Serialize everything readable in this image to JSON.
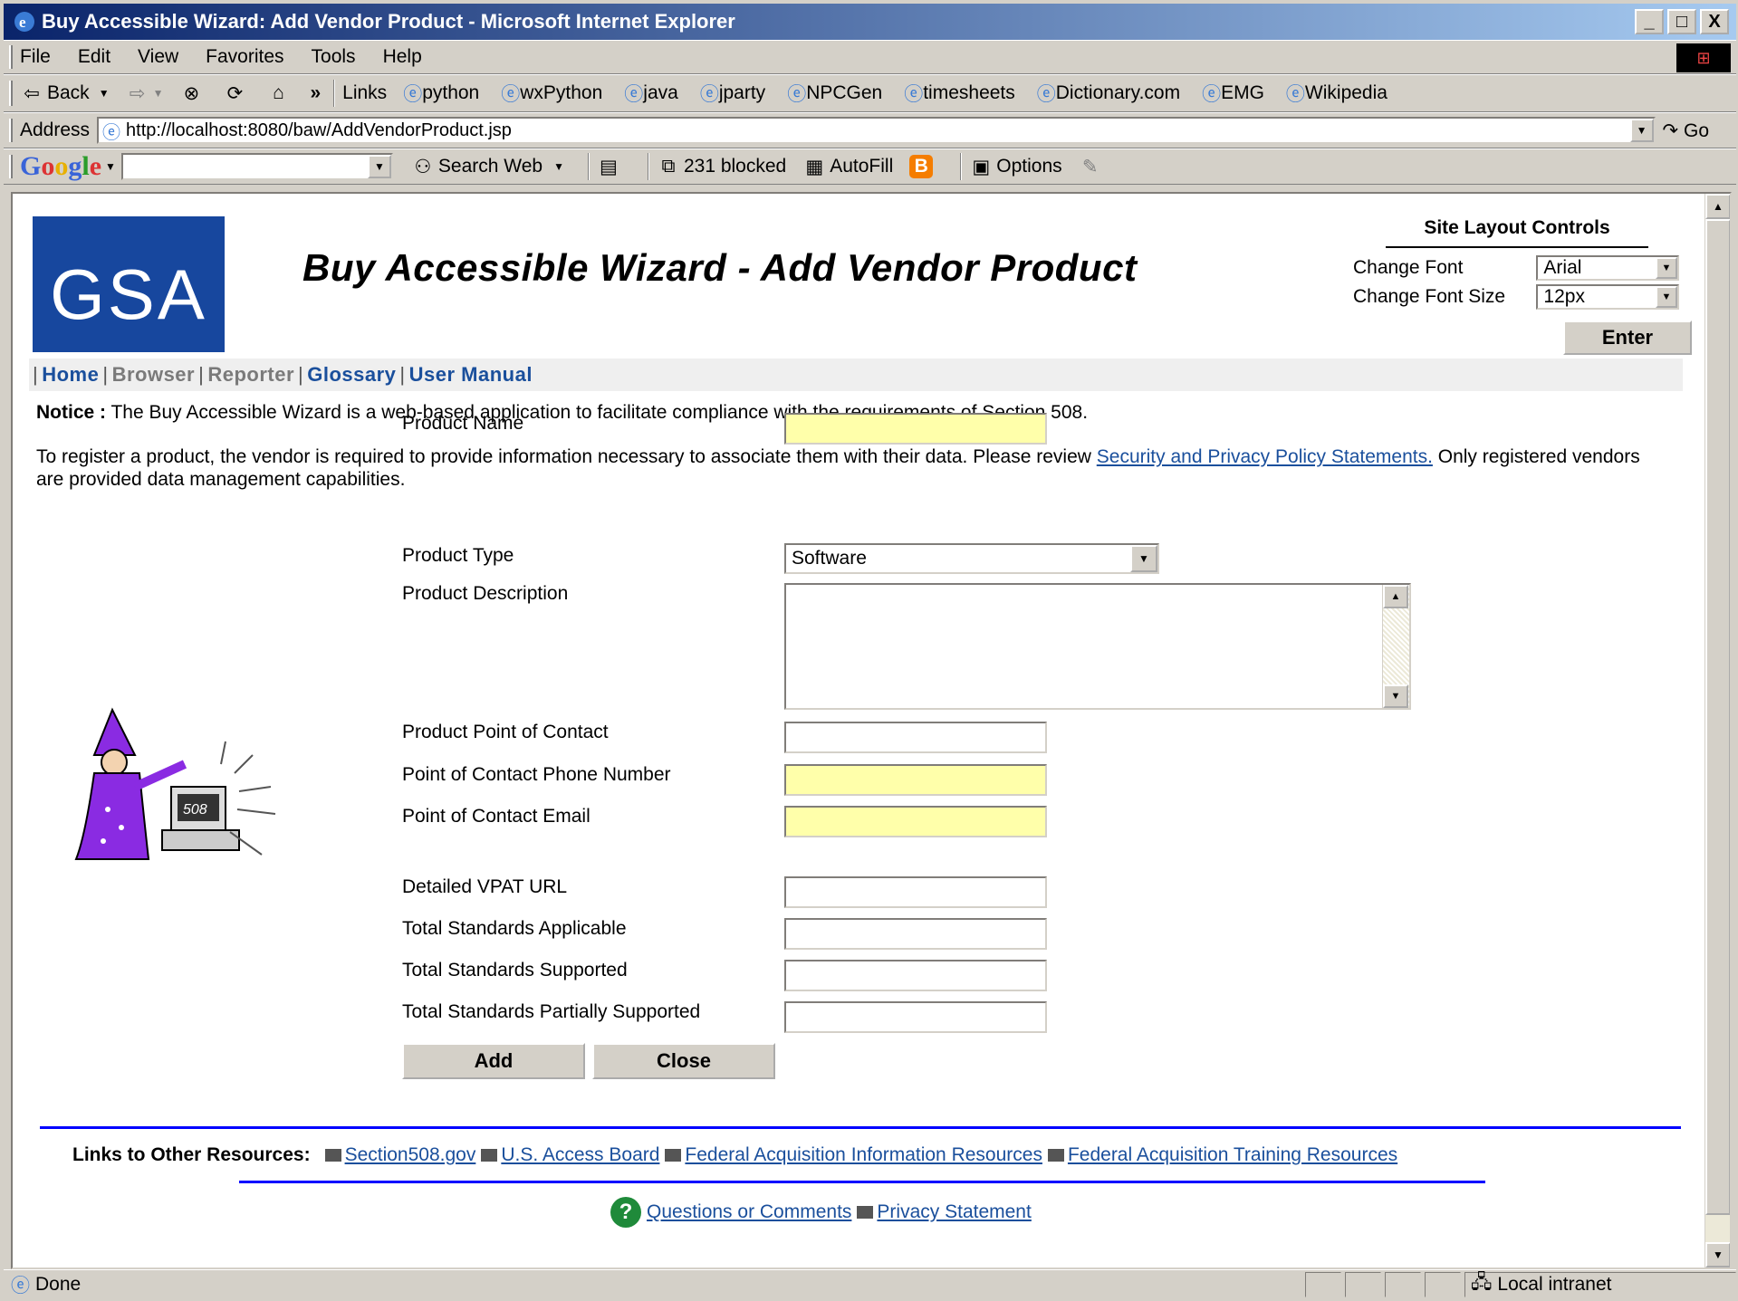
{
  "window": {
    "title": "Buy Accessible Wizard: Add Vendor Product - Microsoft Internet Explorer",
    "buttons": [
      "_",
      "□",
      "X"
    ]
  },
  "menu": [
    "File",
    "Edit",
    "View",
    "Favorites",
    "Tools",
    "Help"
  ],
  "toolbar": {
    "back": "Back",
    "links_label": "Links",
    "links": [
      "python",
      "wxPython",
      "java",
      "jparty",
      "NPCGen",
      "timesheets",
      "Dictionary.com",
      "EMG",
      "Wikipedia"
    ]
  },
  "address": {
    "label": "Address",
    "url": "http://localhost:8080/baw/AddVendorProduct.jsp",
    "go": "Go"
  },
  "google_bar": {
    "logo": "Google",
    "search_web": "Search Web",
    "blocked": "231 blocked",
    "autofill": "AutoFill",
    "options": "Options"
  },
  "page": {
    "logo_text": "GSA",
    "title": "Buy Accessible Wizard - Add Vendor Product",
    "site_layout": {
      "title": "Site Layout Controls",
      "font_label": "Change Font",
      "font_value": "Arial",
      "size_label": "Change Font Size",
      "size_value": "12px",
      "enter": "Enter"
    },
    "nav": [
      {
        "label": "Home",
        "state": "active"
      },
      {
        "label": "Browser",
        "state": "muted"
      },
      {
        "label": "Reporter",
        "state": "muted"
      },
      {
        "label": "Glossary",
        "state": "active"
      },
      {
        "label": "User Manual",
        "state": "active"
      }
    ],
    "notice_label": "Notice :",
    "notice_text": " The Buy Accessible Wizard is a web-based application to facilitate compliance with the requirements of Section 508.",
    "register_text_1": "To register a product, the vendor is required to provide information necessary to associate them with their data. Please review ",
    "register_link": "Security and Privacy Policy Statements.",
    "register_text_2": " Only registered vendors are provided data management capabilities.",
    "form": {
      "product_name": "Product Name",
      "product_type": "Product Type",
      "product_type_value": "Software",
      "product_description": "Product Description",
      "poc": "Product Point of Contact",
      "poc_phone": "Point of Contact Phone Number",
      "poc_email": "Point of Contact Email",
      "vpat_url": "Detailed VPAT URL",
      "std_applicable": "Total Standards Applicable",
      "std_supported": "Total Standards Supported",
      "std_partial": "Total Standards Partially Supported",
      "add": "Add",
      "close": "Close"
    },
    "resources_label": "Links to Other Resources:",
    "resources": [
      "Section508.gov",
      "U.S. Access Board",
      "Federal Acquisition Information Resources",
      "Federal Acquisition Training Resources"
    ],
    "questions": "Questions or Comments",
    "privacy": "Privacy Statement"
  },
  "status": {
    "left": "Done",
    "zone": "Local intranet"
  }
}
